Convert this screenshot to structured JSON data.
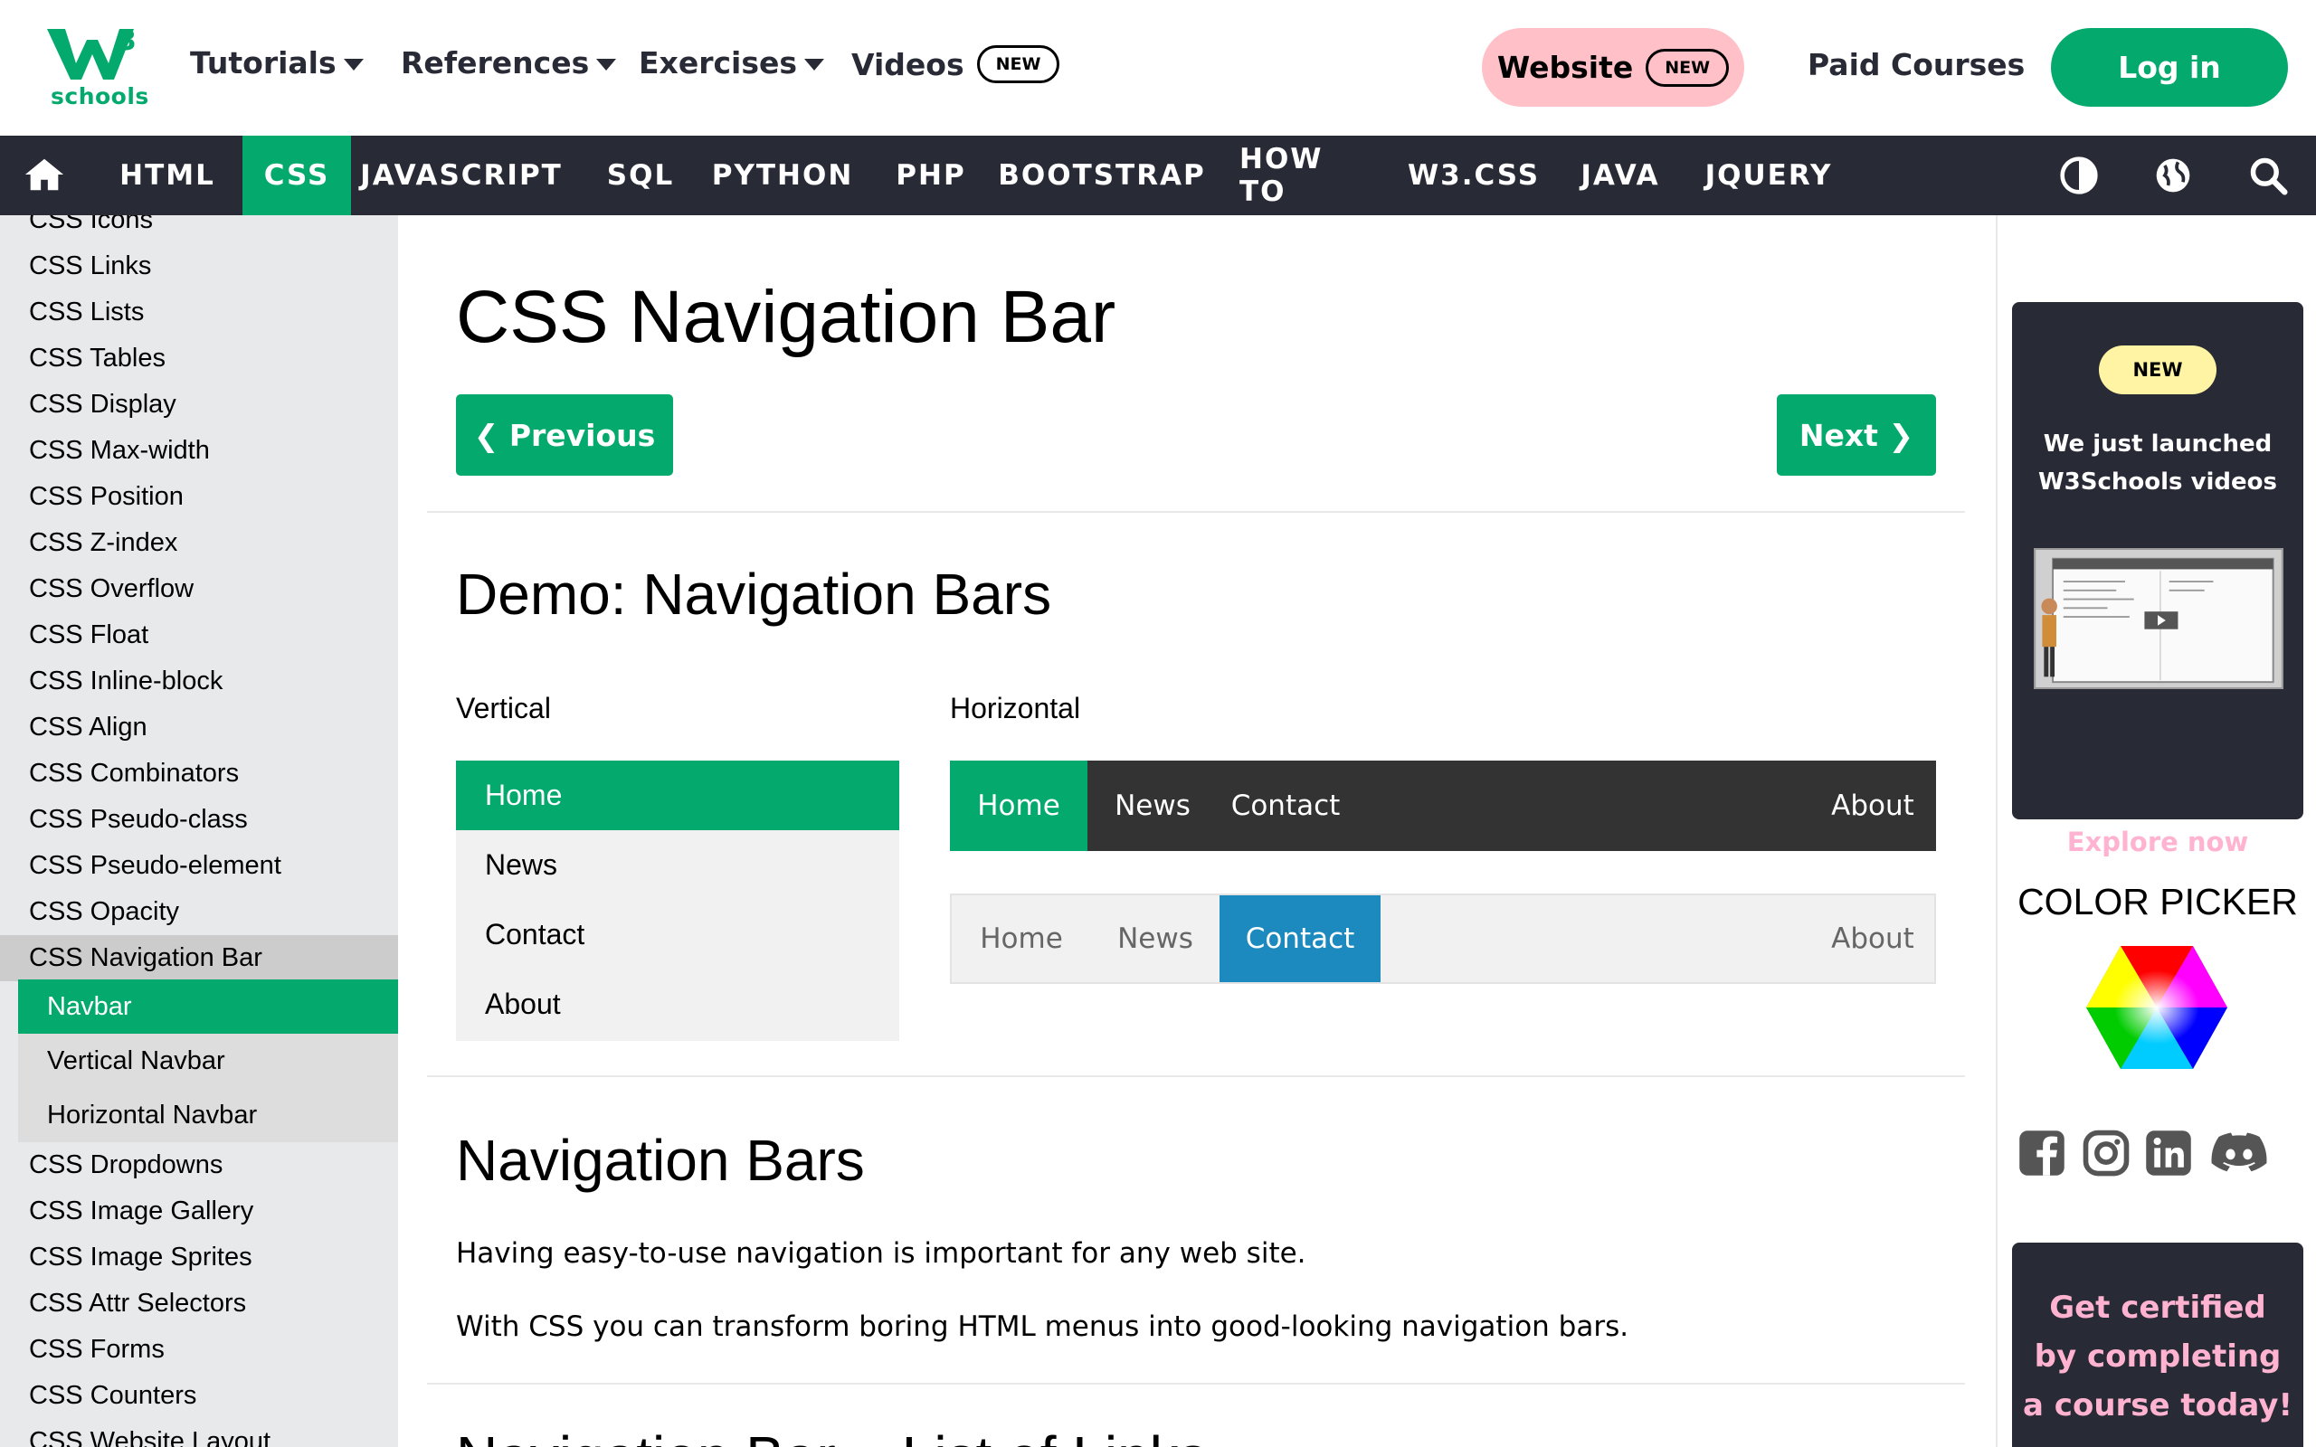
{
  "logo": {
    "sup": "3",
    "sub": "schools"
  },
  "top_menu": [
    {
      "label": "Tutorials",
      "has_caret": true
    },
    {
      "label": "References",
      "has_caret": true
    },
    {
      "label": "Exercises",
      "has_caret": true
    },
    {
      "label": "Videos",
      "badge": "NEW"
    }
  ],
  "website_btn": {
    "label": "Website",
    "badge": "NEW"
  },
  "paid_courses": "Paid Courses",
  "login": "Log in",
  "nav": {
    "items": [
      "HTML",
      "CSS",
      "JAVASCRIPT",
      "SQL",
      "PYTHON",
      "PHP",
      "BOOTSTRAP",
      "HOW TO",
      "W3.CSS",
      "JAVA",
      "JQUERY"
    ],
    "active": "CSS",
    "icons": [
      "home-icon",
      "contrast-icon",
      "globe-icon",
      "search-icon"
    ]
  },
  "sidebar": {
    "items_before": [
      "CSS Icons",
      "CSS Links",
      "CSS Lists",
      "CSS Tables",
      "CSS Display",
      "CSS Max-width",
      "CSS Position",
      "CSS Z-index",
      "CSS Overflow",
      "CSS Float",
      "CSS Inline-block",
      "CSS Align",
      "CSS Combinators",
      "CSS Pseudo-class",
      "CSS Pseudo-element",
      "CSS Opacity"
    ],
    "current": "CSS Navigation Bar",
    "sub_items": [
      "Navbar",
      "Vertical Navbar",
      "Horizontal Navbar"
    ],
    "active_sub": "Navbar",
    "items_after": [
      "CSS Dropdowns",
      "CSS Image Gallery",
      "CSS Image Sprites",
      "CSS Attr Selectors",
      "CSS Forms",
      "CSS Counters",
      "CSS Website Layout"
    ]
  },
  "main": {
    "title": "CSS Navigation Bar",
    "prev": "❮ Previous",
    "next": "Next ❯",
    "demo_heading": "Demo: Navigation Bars",
    "vertical_label": "Vertical",
    "horizontal_label": "Horizontal",
    "vertical_items": [
      "Home",
      "News",
      "Contact",
      "About"
    ],
    "horizontal_dark": [
      "Home",
      "News",
      "Contact",
      "About"
    ],
    "horizontal_light": [
      "Home",
      "News",
      "Contact",
      "About"
    ],
    "section_heading": "Navigation Bars",
    "para1": "Having easy-to-use navigation is important for any web site.",
    "para2": "With CSS you can transform boring HTML menus into good-looking navigation bars.",
    "next_heading_partial": "Navigation Bar = List of Links"
  },
  "right": {
    "promo_badge": "NEW",
    "promo_line1": "We just launched",
    "promo_line2": "W3Schools videos",
    "explore": "Explore now",
    "color_picker": "COLOR PICKER",
    "social": [
      "facebook-icon",
      "instagram-icon",
      "linkedin-icon",
      "discord-icon"
    ],
    "cert1": "Get certified",
    "cert2": "by completing",
    "cert3": "a course today!"
  },
  "colors": {
    "green": "#04AA6D",
    "dark": "#282A35",
    "pink": "#FFC0C7",
    "blue": "#1C8ABF"
  }
}
